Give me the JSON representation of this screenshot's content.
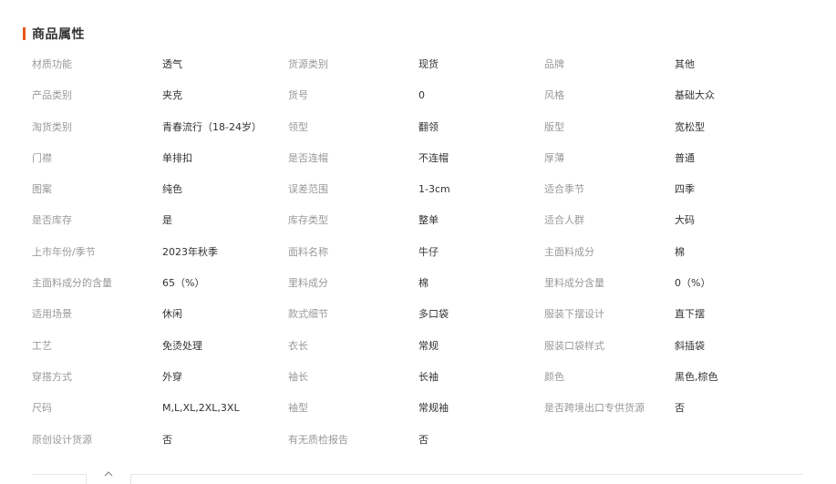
{
  "section": {
    "title": "商品属性"
  },
  "attributes": [
    [
      {
        "label": "材质功能",
        "value": "透气"
      },
      {
        "label": "货源类别",
        "value": "现货"
      },
      {
        "label": "品牌",
        "value": "其他"
      }
    ],
    [
      {
        "label": "产品类别",
        "value": "夹克"
      },
      {
        "label": "货号",
        "value": "0"
      },
      {
        "label": "风格",
        "value": "基础大众"
      }
    ],
    [
      {
        "label": "淘货类别",
        "value": "青春流行（18-24岁）"
      },
      {
        "label": "领型",
        "value": "翻领"
      },
      {
        "label": "版型",
        "value": "宽松型"
      }
    ],
    [
      {
        "label": "门襟",
        "value": "单排扣"
      },
      {
        "label": "是否连帽",
        "value": "不连帽"
      },
      {
        "label": "厚薄",
        "value": "普通"
      }
    ],
    [
      {
        "label": "图案",
        "value": "纯色"
      },
      {
        "label": "误差范围",
        "value": "1-3cm"
      },
      {
        "label": "适合季节",
        "value": "四季"
      }
    ],
    [
      {
        "label": "是否库存",
        "value": "是"
      },
      {
        "label": "库存类型",
        "value": "整单"
      },
      {
        "label": "适合人群",
        "value": "大码"
      }
    ],
    [
      {
        "label": "上市年份/季节",
        "value": "2023年秋季"
      },
      {
        "label": "面料名称",
        "value": "牛仔"
      },
      {
        "label": "主面料成分",
        "value": "棉"
      }
    ],
    [
      {
        "label": "主面料成分的含量",
        "value": "65（%）"
      },
      {
        "label": "里料成分",
        "value": "棉"
      },
      {
        "label": "里料成分含量",
        "value": "0（%）"
      }
    ],
    [
      {
        "label": "适用场景",
        "value": "休闲"
      },
      {
        "label": "款式细节",
        "value": "多口袋"
      },
      {
        "label": "服装下摆设计",
        "value": "直下摆"
      }
    ],
    [
      {
        "label": "工艺",
        "value": "免烫处理"
      },
      {
        "label": "衣长",
        "value": "常规"
      },
      {
        "label": "服装口袋样式",
        "value": "斜插袋"
      }
    ],
    [
      {
        "label": "穿搭方式",
        "value": "外穿"
      },
      {
        "label": "袖长",
        "value": "长袖"
      },
      {
        "label": "颜色",
        "value": "黑色,棕色"
      }
    ],
    [
      {
        "label": "尺码",
        "value": "M,L,XL,2XL,3XL"
      },
      {
        "label": "袖型",
        "value": "常规袖"
      },
      {
        "label": "是否跨境出口专供货源",
        "value": "否"
      }
    ],
    [
      {
        "label": "原创设计货源",
        "value": "否"
      },
      {
        "label": "有无质检报告",
        "value": "否"
      }
    ]
  ],
  "colors": {
    "accent": "#e8561b",
    "label": "#999999",
    "value": "#333333"
  },
  "icons": {
    "collapse": "chevron-up-icon"
  }
}
